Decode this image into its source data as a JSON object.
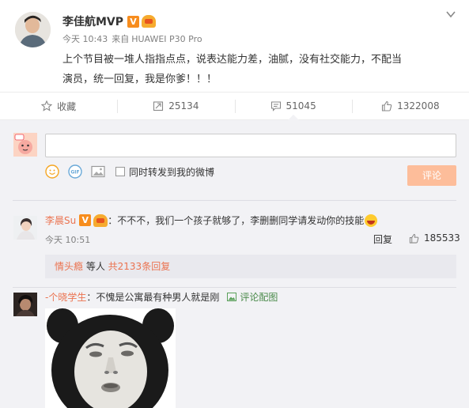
{
  "post": {
    "author": "李佳航MVP",
    "verified_badge": "V",
    "time": "今天 10:43",
    "source_prefix": "来自",
    "device": "HUAWEI P30 Pro",
    "text": "上个节目被一堆人指指点点，说表达能力差，油腻，没有社交能力，不配当演员，统一回复，我是你爹！！！"
  },
  "actions": {
    "favorite": "收藏",
    "repost_count": "25134",
    "comment_count": "51045",
    "like_count": "1322008"
  },
  "composer": {
    "input_placeholder": "",
    "repost_label": "同时转发到我的微博",
    "submit_label": "评论",
    "submit_color": "#fdbd9a"
  },
  "comments": [
    {
      "user": "李晨Su",
      "badge": "V",
      "separator": "：",
      "text": "不不不，我们一个孩子就够了，李删删同学请发动你的技能",
      "time": "今天 10:51",
      "reply_label": "回复",
      "like_count": "185533",
      "sub_replies": {
        "first_user": "情头瘾",
        "middle": " 等人 ",
        "total": "共2133条回复"
      }
    },
    {
      "user": "-个晓学生",
      "separator": "：",
      "text": "不愧是公寓最有种男人就是刚",
      "pic_label": "评论配图"
    }
  ],
  "colors": {
    "accent": "#eb7350",
    "background_comments": "#f2f2f5",
    "verified": "#f78d1e"
  },
  "icons": [
    "star-icon",
    "repost-icon",
    "comment-icon",
    "like-icon",
    "chevron-down-icon",
    "emoji-icon",
    "gif-icon",
    "image-icon",
    "laugh-emoji-icon",
    "picture-icon"
  ]
}
